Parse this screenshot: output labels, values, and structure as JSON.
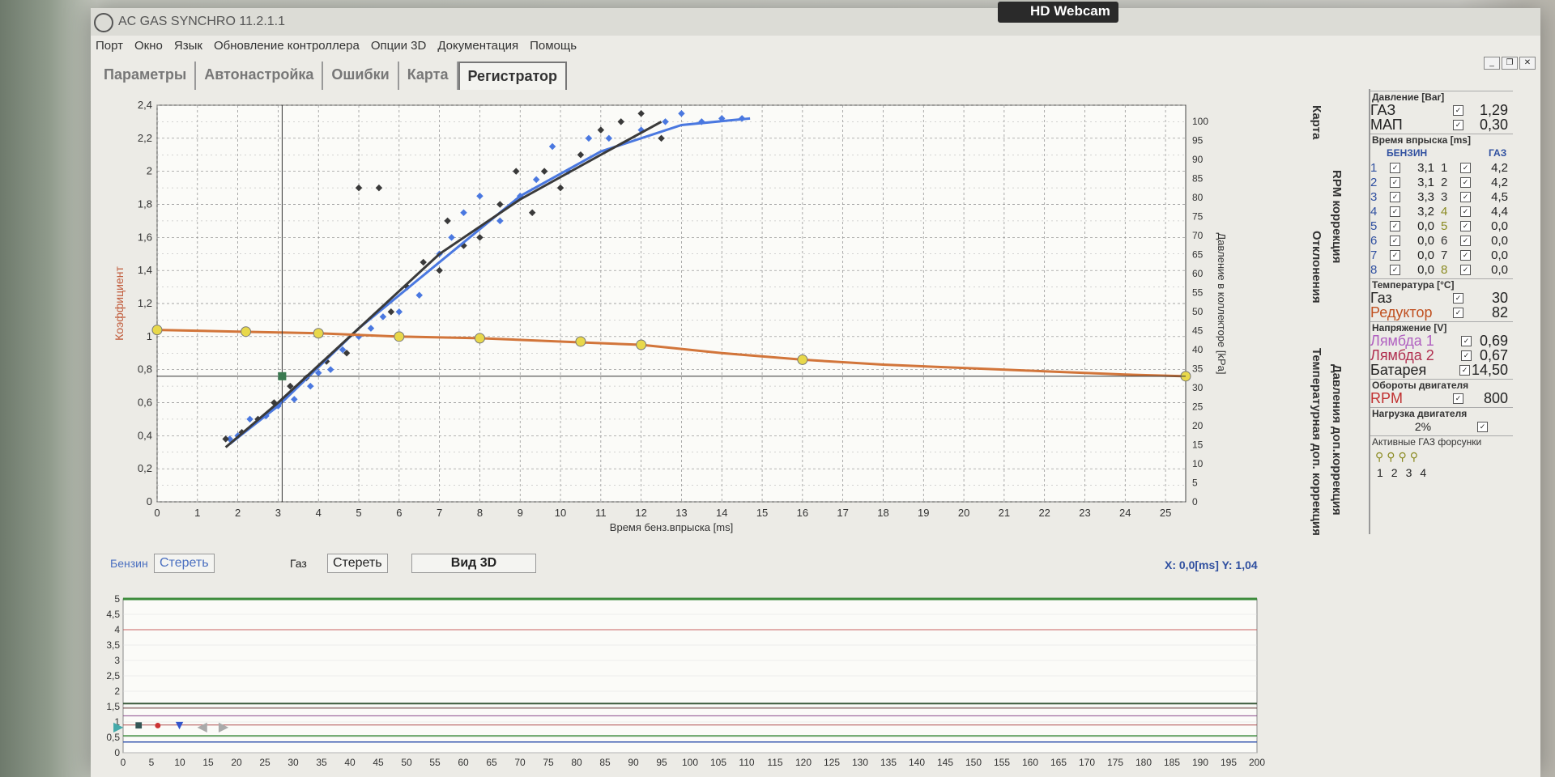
{
  "window": {
    "title": "AC GAS SYNCHRO 11.2.1.1",
    "webcam_label": "HD Webcam"
  },
  "menu": [
    "Порт",
    "Окно",
    "Язык",
    "Обновление контроллера",
    "Опции 3D",
    "Документация",
    "Помощь"
  ],
  "tabs": [
    {
      "label": "Параметры",
      "active": false
    },
    {
      "label": "Автонастройка",
      "active": false
    },
    {
      "label": "Ошибки",
      "active": false
    },
    {
      "label": "Карта",
      "active": false
    },
    {
      "label": "Регистратор",
      "active": true
    }
  ],
  "side_tabs": [
    "Карта",
    "RPM коррекция",
    "Отклонения",
    "Давления доп.коррекция",
    "Температурная доп. коррекция"
  ],
  "chart_data": {
    "type": "scatter",
    "xlabel": "Время бенз.впрыска [ms]",
    "ylabel": "Коэффициент",
    "y2label": "Давление в коллекторе [kPa]",
    "xlim": [
      0,
      25.5
    ],
    "ylim": [
      0,
      2.4
    ],
    "y2lim": [
      0,
      100
    ],
    "xticks": [
      "0",
      "1",
      "2",
      "3",
      "4",
      "5",
      "6",
      "7",
      "8",
      "9",
      "10",
      "11",
      "12",
      "13",
      "14",
      "15",
      "16",
      "17",
      "18",
      "19",
      "20",
      "21",
      "22",
      "23",
      "24",
      "25"
    ],
    "yticks": [
      "0",
      "0,2",
      "0,4",
      "0,6",
      "0,8",
      "1",
      "1,2",
      "1,4",
      "1,6",
      "1,8",
      "2",
      "2,2",
      "2,4"
    ],
    "y2ticks": [
      "0",
      "5",
      "10",
      "15",
      "20",
      "25",
      "30",
      "35",
      "40",
      "45",
      "50",
      "55",
      "60",
      "65",
      "70",
      "75",
      "80",
      "85",
      "90",
      "95",
      "100"
    ],
    "grid": true,
    "series": [
      {
        "color": "#4a78e0",
        "points": [
          [
            1.8,
            0.38
          ],
          [
            2,
            0.4
          ],
          [
            2.3,
            0.5
          ],
          [
            2.7,
            0.52
          ],
          [
            3,
            0.58
          ],
          [
            3.4,
            0.62
          ],
          [
            3.8,
            0.7
          ],
          [
            4,
            0.78
          ],
          [
            4.3,
            0.8
          ],
          [
            4.6,
            0.92
          ],
          [
            5,
            1.0
          ],
          [
            5.3,
            1.05
          ],
          [
            5.6,
            1.12
          ],
          [
            6,
            1.15
          ],
          [
            6.5,
            1.25
          ],
          [
            7,
            1.5
          ],
          [
            7.3,
            1.6
          ],
          [
            7.6,
            1.75
          ],
          [
            8,
            1.85
          ],
          [
            8.5,
            1.7
          ],
          [
            9,
            1.85
          ],
          [
            9.4,
            1.95
          ],
          [
            9.8,
            2.15
          ],
          [
            10.2,
            2.0
          ],
          [
            10.7,
            2.2
          ],
          [
            11.2,
            2.2
          ],
          [
            12,
            2.25
          ],
          [
            12.6,
            2.3
          ],
          [
            13,
            2.35
          ],
          [
            13.5,
            2.3
          ],
          [
            14,
            2.32
          ],
          [
            14.5,
            2.32
          ]
        ]
      },
      {
        "color": "#3a3a3a",
        "points": [
          [
            1.7,
            0.38
          ],
          [
            2.1,
            0.42
          ],
          [
            2.5,
            0.5
          ],
          [
            2.9,
            0.6
          ],
          [
            3.3,
            0.7
          ],
          [
            3.7,
            0.75
          ],
          [
            4.2,
            0.85
          ],
          [
            4.7,
            0.9
          ],
          [
            5,
            1.9
          ],
          [
            5.5,
            1.9
          ],
          [
            5.8,
            1.15
          ],
          [
            6.2,
            1.3
          ],
          [
            6.6,
            1.45
          ],
          [
            7,
            1.4
          ],
          [
            7.2,
            1.7
          ],
          [
            7.6,
            1.55
          ],
          [
            8,
            1.6
          ],
          [
            8.5,
            1.8
          ],
          [
            8.9,
            2.0
          ],
          [
            9.3,
            1.75
          ],
          [
            9.6,
            2.0
          ],
          [
            10,
            1.9
          ],
          [
            10.5,
            2.1
          ],
          [
            11,
            2.25
          ],
          [
            11.5,
            2.3
          ],
          [
            12,
            2.35
          ],
          [
            12.5,
            2.2
          ]
        ]
      },
      {
        "color": "#4a78e0",
        "fit": [
          [
            1.8,
            0.35
          ],
          [
            3,
            0.58
          ],
          [
            5,
            1.05
          ],
          [
            7,
            1.45
          ],
          [
            9,
            1.85
          ],
          [
            11,
            2.12
          ],
          [
            13,
            2.28
          ],
          [
            14.7,
            2.32
          ]
        ]
      },
      {
        "color": "#3a3a3a",
        "fit": [
          [
            1.7,
            0.33
          ],
          [
            3,
            0.6
          ],
          [
            5,
            1.05
          ],
          [
            7,
            1.5
          ],
          [
            9,
            1.83
          ],
          [
            11,
            2.1
          ],
          [
            12.5,
            2.3
          ]
        ]
      },
      {
        "color": "#d2753a",
        "name": "коэффициент",
        "line": [
          [
            0,
            1.04
          ],
          [
            2,
            1.03
          ],
          [
            4,
            1.02
          ],
          [
            6,
            1.0
          ],
          [
            8,
            0.99
          ],
          [
            10,
            0.97
          ],
          [
            12,
            0.95
          ],
          [
            14,
            0.9
          ],
          [
            16,
            0.86
          ],
          [
            18,
            0.83
          ],
          [
            20,
            0.81
          ],
          [
            22,
            0.79
          ],
          [
            24,
            0.77
          ],
          [
            25.5,
            0.76
          ]
        ]
      },
      {
        "color": "#e8d84a",
        "name": "узлы",
        "points": [
          [
            0,
            1.04
          ],
          [
            2.2,
            1.03
          ],
          [
            4,
            1.02
          ],
          [
            6,
            1.0
          ],
          [
            8,
            0.99
          ],
          [
            10.5,
            0.97
          ],
          [
            12,
            0.95
          ],
          [
            16,
            0.86
          ],
          [
            25.5,
            0.76
          ]
        ]
      }
    ],
    "cursor": {
      "x": 3.1,
      "y": 0.76
    }
  },
  "controls": {
    "benzin_label": "Бензин",
    "benzin_clear": "Стереть",
    "gas_label": "Газ",
    "gas_clear": "Стереть",
    "view3d": "Вид 3D",
    "coord_x_label": "X:",
    "coord_x": "0,0[ms]",
    "coord_y_label": "Y:",
    "coord_y": "1,04"
  },
  "panel": {
    "pressure": {
      "title": "Давление [Bar]",
      "rows": [
        {
          "label": "ГАЗ",
          "value": "1,29"
        },
        {
          "label": "МАП",
          "value": "0,30"
        }
      ]
    },
    "injection": {
      "title": "Время впрыска [ms]",
      "col_benzin": "БЕНЗИН",
      "col_gas": "ГАЗ",
      "rows": [
        {
          "n": "1",
          "b": "3,1",
          "g": "4,2"
        },
        {
          "n": "2",
          "b": "3,1",
          "g": "4,2"
        },
        {
          "n": "3",
          "b": "3,3",
          "g": "4,5"
        },
        {
          "n": "4",
          "b": "3,2",
          "g": "4,4"
        },
        {
          "n": "5",
          "b": "0,0",
          "g": "0,0"
        },
        {
          "n": "6",
          "b": "0,0",
          "g": "0,0"
        },
        {
          "n": "7",
          "b": "0,0",
          "g": "0,0"
        },
        {
          "n": "8",
          "b": "0,0",
          "g": "0,0"
        }
      ]
    },
    "temperature": {
      "title": "Температура [°C]",
      "rows": [
        {
          "label": "Газ",
          "value": "30"
        },
        {
          "label": "Редуктор",
          "value": "82"
        }
      ]
    },
    "voltage": {
      "title": "Напряжение [V]",
      "rows": [
        {
          "label": "Лямбда 1",
          "value": "0,69"
        },
        {
          "label": "Лямбда 2",
          "value": "0,67"
        },
        {
          "label": "Батарея",
          "value": "14,50"
        }
      ]
    },
    "rpm": {
      "title": "Обороты двигателя",
      "label": "RPM",
      "value": "800"
    },
    "load": {
      "title": "Нагрузка двигателя",
      "value": "2%"
    },
    "injectors": {
      "title": "Активные ГАЗ форсунки",
      "labels": [
        "1",
        "2",
        "3",
        "4"
      ]
    }
  },
  "recorder": {
    "yticks": [
      "0",
      "0,5",
      "1",
      "1,5",
      "2",
      "2,5",
      "3",
      "3,5",
      "4",
      "4,5",
      "5"
    ],
    "xticks": [
      "0",
      "5",
      "10",
      "15",
      "20",
      "25",
      "30",
      "35",
      "40",
      "45",
      "50",
      "55",
      "60",
      "65",
      "70",
      "75",
      "80",
      "85",
      "90",
      "95",
      "100",
      "105",
      "110",
      "115",
      "120",
      "125",
      "130",
      "135",
      "140",
      "145",
      "150",
      "155",
      "160",
      "165",
      "170",
      "175",
      "180",
      "185",
      "190",
      "195",
      "200"
    ]
  }
}
